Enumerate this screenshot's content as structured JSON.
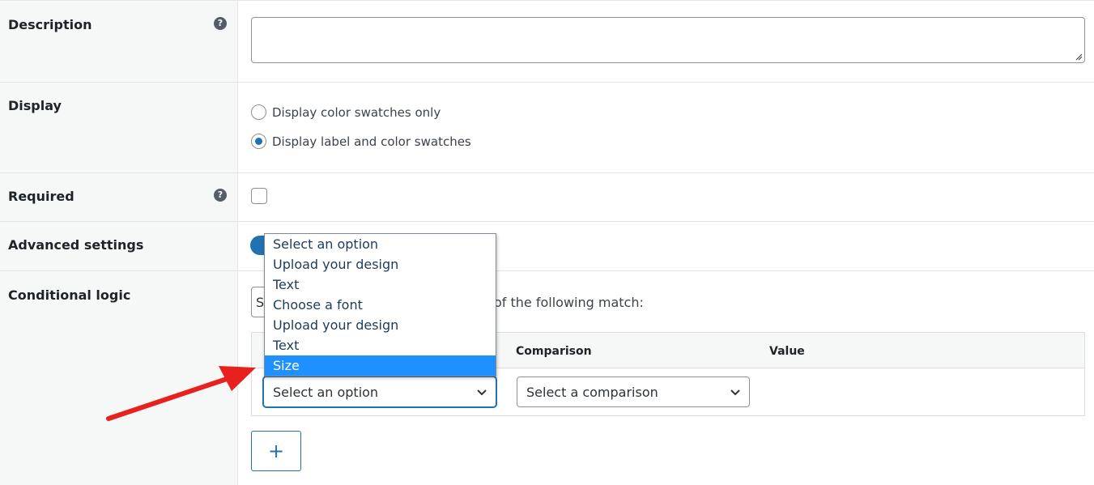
{
  "fields": {
    "description": {
      "label": "Description",
      "help": "?"
    },
    "display": {
      "label": "Display",
      "options": [
        {
          "label": "Display color swatches only",
          "checked": false
        },
        {
          "label": "Display label and color swatches",
          "checked": true
        }
      ]
    },
    "required": {
      "label": "Required",
      "help": "?",
      "checked": false
    },
    "advanced": {
      "label": "Advanced settings",
      "enabled": true
    },
    "conditional": {
      "label": "Conditional logic",
      "match_select_partial": "S",
      "match_text": "of the following match:",
      "table": {
        "col_comparison": "Comparison",
        "col_value": "Value",
        "option_select": "Select an option",
        "comparison_select": "Select a comparison"
      },
      "add_button": "+"
    }
  },
  "dropdown": {
    "items": [
      {
        "label": "Select an option",
        "selected": false
      },
      {
        "label": "Upload your design",
        "selected": false
      },
      {
        "label": "Text",
        "selected": false
      },
      {
        "label": "Choose a font",
        "selected": false
      },
      {
        "label": "Upload your design",
        "selected": false
      },
      {
        "label": "Text",
        "selected": false
      },
      {
        "label": "Size",
        "selected": true
      }
    ]
  },
  "colors": {
    "accent": "#2271b1",
    "highlight": "#1e90ff",
    "arrow": "#e8201e"
  }
}
